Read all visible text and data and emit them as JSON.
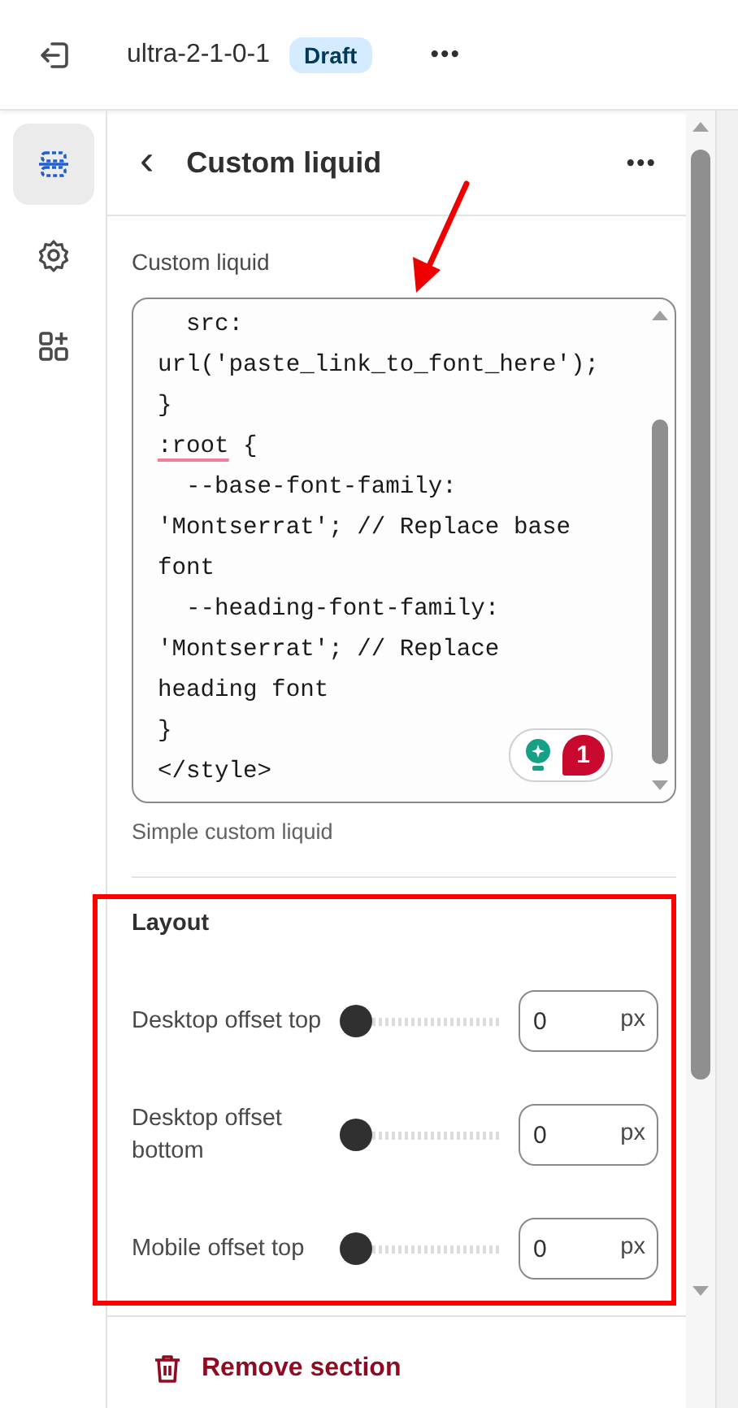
{
  "topbar": {
    "theme_name": "ultra-2-1-0-1",
    "status_badge": "Draft",
    "more": "•••"
  },
  "rail": [
    {
      "kind": "sections",
      "selected": true
    },
    {
      "kind": "settings",
      "selected": false
    },
    {
      "kind": "apps",
      "selected": false
    }
  ],
  "panel": {
    "back": "‹",
    "title": "Custom liquid",
    "more": "•••"
  },
  "code_field": {
    "label": "Custom liquid",
    "lines": [
      [
        {
          "text": "  src:",
          "flagged": false
        }
      ],
      [
        {
          "text": "url('paste_link_to_font_here');",
          "flagged": false
        }
      ],
      [
        {
          "text": "}",
          "flagged": false
        }
      ],
      [
        {
          "text": ":root",
          "flagged": true
        },
        {
          "text": " {",
          "flagged": false
        }
      ],
      [
        {
          "text": "  --base-font-family:",
          "flagged": false
        }
      ],
      [
        {
          "text": "'Montserrat'; // Replace base",
          "flagged": false
        }
      ],
      [
        {
          "text": "font",
          "flagged": false
        }
      ],
      [
        {
          "text": "  --heading-font-family:",
          "flagged": false
        }
      ],
      [
        {
          "text": "'Montserrat'; // Replace",
          "flagged": false
        }
      ],
      [
        {
          "text": "heading font",
          "flagged": false
        }
      ],
      [
        {
          "text": "}",
          "flagged": false
        }
      ],
      [
        {
          "text": "</style>",
          "flagged": false
        }
      ]
    ],
    "issue_count": "1",
    "help": "Simple custom liquid"
  },
  "layout": {
    "heading": "Layout",
    "settings": [
      {
        "label": "Desktop offset top",
        "level": 0,
        "value": "0",
        "unit": "px"
      },
      {
        "label": "Desktop offset bottom",
        "level": 0,
        "value": "0",
        "unit": "px"
      },
      {
        "label": "Mobile offset top",
        "level": 0,
        "value": "0",
        "unit": "px"
      }
    ]
  },
  "remove_button": "Remove section"
}
